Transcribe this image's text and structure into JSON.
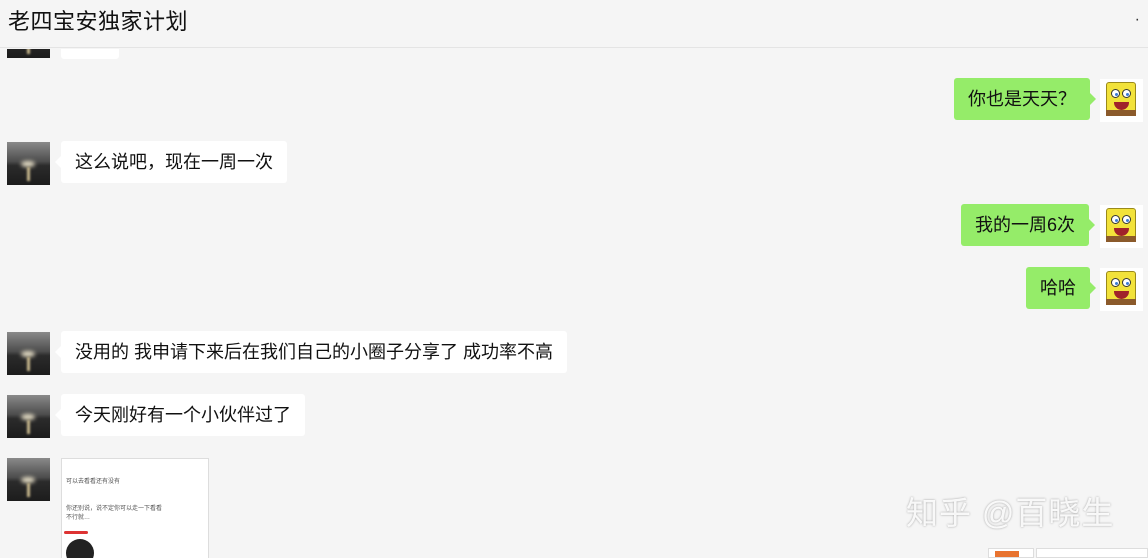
{
  "header": {
    "title": "老四宝安独家计划",
    "menu_glyph": "·"
  },
  "messages": [
    {
      "side": "right",
      "text": "你也是天天？"
    },
    {
      "side": "left",
      "text": "这么说吧，现在一周一次"
    },
    {
      "side": "right",
      "text": "我的一周6次"
    },
    {
      "side": "right",
      "text": "哈哈"
    },
    {
      "side": "left",
      "text": "没用的 我申请下来后在我们自己的小圈子分享了 成功率不高"
    },
    {
      "side": "left",
      "text": "今天刚好有一个小伙伴过了"
    }
  ],
  "image_message": {
    "lines": [
      "可以去看看还有没有",
      "你还别说，说不定你可以走一下看看",
      "不行就…"
    ]
  },
  "watermark": "知乎 @百晓生",
  "colors": {
    "own_bubble": "#95ec69",
    "other_bubble": "#ffffff",
    "background": "#f5f5f5"
  }
}
